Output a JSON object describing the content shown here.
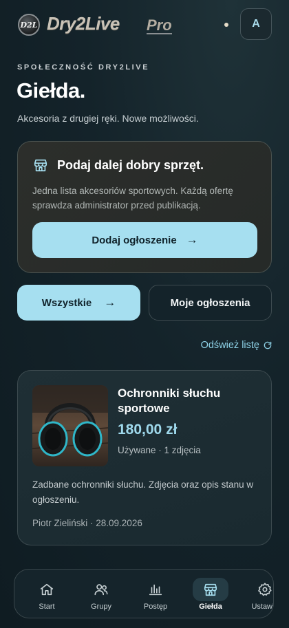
{
  "header": {
    "logo_badge": "D2L",
    "logo_text": "Dry2Live",
    "logo_pro": "Pro",
    "avatar_initial": "A"
  },
  "page": {
    "eyebrow": "SPOŁECZNOŚĆ DRY2LIVE",
    "title": "Giełda.",
    "subtitle": "Akcesoria z drugiej ręki. Nowe możliwości."
  },
  "promo": {
    "icon": "store-icon",
    "title": "Podaj dalej dobry sprzęt.",
    "description": "Jedna lista akcesoriów sportowych. Każdą ofertę sprawdza administrator przed publikacją.",
    "button_label": "Dodaj ogłoszenie",
    "button_icon": "arrow-right-icon"
  },
  "filters": {
    "all_label": "Wszystkie",
    "all_icon": "arrow-right-icon",
    "mine_label": "Moje ogłoszenia"
  },
  "refresh": {
    "label": "Odśwież listę",
    "icon": "refresh-icon"
  },
  "listings": [
    {
      "title": "Ochronniki słuchu sportowe",
      "price": "180,00 zł",
      "meta": "Używane · 1 zdjęcia",
      "description": "Zadbane ochronniki słuchu. Zdjęcia oraz opis stanu w ogłoszeniu.",
      "author_date": "Piotr Zieliński · 28.09.2026",
      "photo": "earmuffs-photo"
    }
  ],
  "nav": {
    "items": [
      {
        "label": "Start",
        "icon": "home-icon",
        "active": false
      },
      {
        "label": "Grupy",
        "icon": "users-icon",
        "active": false
      },
      {
        "label": "Postęp",
        "icon": "bar-chart-icon",
        "active": false
      },
      {
        "label": "Giełda",
        "icon": "store-icon",
        "active": true
      },
      {
        "label": "Ustawie",
        "icon": "settings-icon",
        "active": false
      }
    ]
  },
  "colors": {
    "accent": "#a6dff0",
    "price": "#9fd9ec",
    "background": "#14232a"
  }
}
